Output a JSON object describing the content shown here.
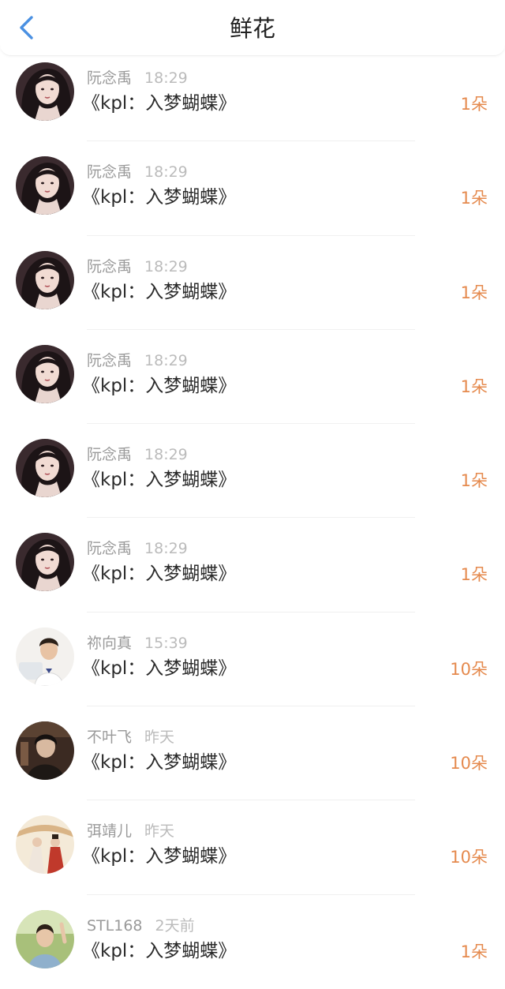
{
  "header": {
    "title": "鲜花",
    "back_icon": "chevron-left-icon",
    "accent_color": "#4a90e2"
  },
  "colors": {
    "count": "#e58a4e",
    "name": "#9a9a9a",
    "time": "#bbbbbb"
  },
  "items": [
    {
      "name": "阮念禹",
      "time": "18:29",
      "book": "《kpl：入梦蝴蝶》",
      "count": "1朵",
      "avatar": "woman-dark-hair"
    },
    {
      "name": "阮念禹",
      "time": "18:29",
      "book": "《kpl：入梦蝴蝶》",
      "count": "1朵",
      "avatar": "woman-dark-hair"
    },
    {
      "name": "阮念禹",
      "time": "18:29",
      "book": "《kpl：入梦蝴蝶》",
      "count": "1朵",
      "avatar": "woman-dark-hair"
    },
    {
      "name": "阮念禹",
      "time": "18:29",
      "book": "《kpl：入梦蝴蝶》",
      "count": "1朵",
      "avatar": "woman-dark-hair"
    },
    {
      "name": "阮念禹",
      "time": "18:29",
      "book": "《kpl：入梦蝴蝶》",
      "count": "1朵",
      "avatar": "woman-dark-hair"
    },
    {
      "name": "阮念禹",
      "time": "18:29",
      "book": "《kpl：入梦蝴蝶》",
      "count": "1朵",
      "avatar": "woman-dark-hair"
    },
    {
      "name": "祢向真",
      "time": "15:39",
      "book": "《kpl：入梦蝴蝶》",
      "count": "10朵",
      "avatar": "man-white-shirt"
    },
    {
      "name": "不叶飞",
      "time": "昨天",
      "book": "《kpl：入梦蝴蝶》",
      "count": "10朵",
      "avatar": "person-dark-scene"
    },
    {
      "name": "弭靖儿",
      "time": "昨天",
      "book": "《kpl：入梦蝴蝶》",
      "count": "10朵",
      "avatar": "costume-couple"
    },
    {
      "name": "STL168",
      "time": "2天前",
      "book": "《kpl：入梦蝴蝶》",
      "count": "1朵",
      "avatar": "boy-outdoors"
    }
  ]
}
